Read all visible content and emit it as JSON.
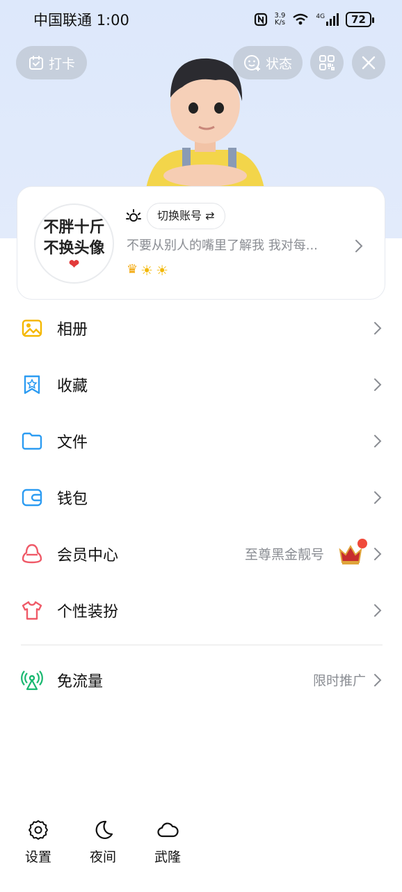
{
  "status_bar": {
    "carrier": "中国联通",
    "time": "1:00",
    "net_speed_value": "3.9",
    "net_speed_unit": "K/s",
    "network": "4G",
    "battery": "72"
  },
  "header": {
    "checkin_label": "打卡",
    "status_label": "状态"
  },
  "profile": {
    "avatar_line1": "不胖十斤",
    "avatar_line2": "不换头像",
    "switch_account_label": "切换账号 ⇄",
    "signature": "不要从别人的嘴里了解我 我对每..."
  },
  "menu": [
    {
      "label": "相册",
      "icon": "album-icon",
      "right_text": ""
    },
    {
      "label": "收藏",
      "icon": "favorites-icon",
      "right_text": ""
    },
    {
      "label": "文件",
      "icon": "folder-icon",
      "right_text": ""
    },
    {
      "label": "钱包",
      "icon": "wallet-icon",
      "right_text": ""
    },
    {
      "label": "会员中心",
      "icon": "member-icon",
      "right_text": "至尊黑金靓号"
    },
    {
      "label": "个性装扮",
      "icon": "shirt-icon",
      "right_text": ""
    },
    {
      "label": "免流量",
      "icon": "free-data-icon",
      "right_text": "限时推广"
    }
  ],
  "bottom_bar": {
    "settings_label": "设置",
    "night_label": "夜间",
    "weather_label": "武隆"
  },
  "colors": {
    "top_background": "#dde8fb",
    "album": "#f5b800",
    "blue": "#2d9cf2",
    "member_red": "#ef5a68",
    "green": "#19b870",
    "badge": "#f04a3a"
  }
}
